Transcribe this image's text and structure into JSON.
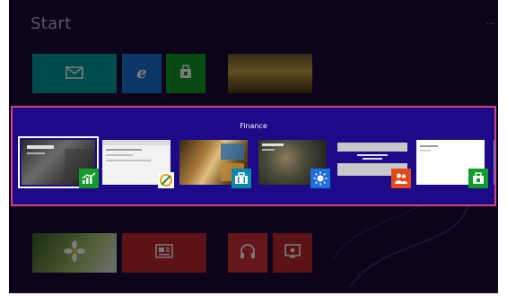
{
  "start": {
    "title": "Start",
    "user": "…"
  },
  "tiles": [
    {
      "id": "mail",
      "icon": "mail-icon",
      "color": "#00a0a0"
    },
    {
      "id": "ie",
      "icon": "internet-explorer-icon",
      "color": "#1e73d8"
    },
    {
      "id": "store",
      "icon": "store-icon",
      "color": "#0f9d2a"
    },
    {
      "id": "photos",
      "icon": "landscape-photo",
      "color": "#c9a24a"
    },
    {
      "id": "flower",
      "icon": "flower-photo",
      "color": "#a4c46a"
    },
    {
      "id": "news",
      "icon": "news-icon",
      "color": "#c3262e"
    },
    {
      "id": "music",
      "icon": "headphones-icon",
      "color": "#d13438"
    },
    {
      "id": "video",
      "icon": "video-icon",
      "color": "#c3262e"
    }
  ],
  "switcher": {
    "title": "Finance",
    "accent": "#d1447e",
    "background": "#1d0a88",
    "apps": [
      {
        "name": "finance",
        "icon": "finance-chart-icon",
        "selected": true
      },
      {
        "name": "explorer",
        "icon": "explorer-icon",
        "selected": false
      },
      {
        "name": "travel",
        "icon": "travel-suitcase-icon",
        "selected": false
      },
      {
        "name": "weather",
        "icon": "weather-sun-icon",
        "selected": false
      },
      {
        "name": "people",
        "icon": "people-icon",
        "selected": false
      },
      {
        "name": "store",
        "icon": "store-bag-icon",
        "selected": false
      }
    ]
  }
}
